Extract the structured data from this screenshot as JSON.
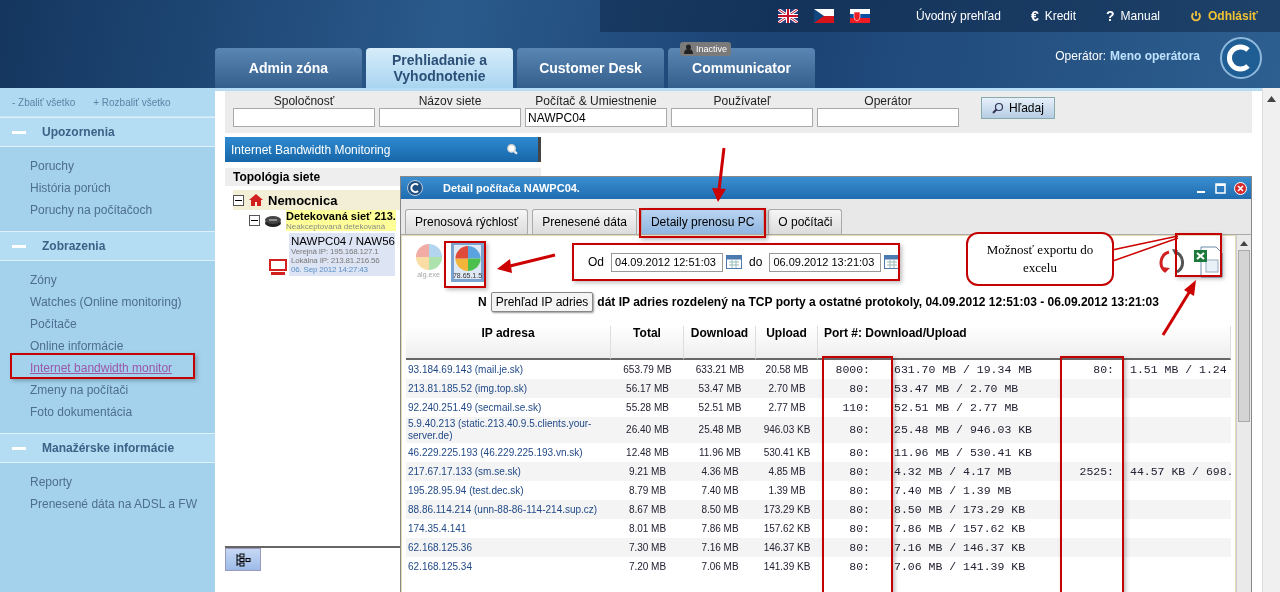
{
  "header": {
    "links": [
      {
        "label": "Úvodný prehľad",
        "kind": "plain"
      },
      {
        "label": "Kredit",
        "kind": "glyph",
        "glyph": "€"
      },
      {
        "label": "Manual",
        "kind": "glyph",
        "glyph": "?"
      },
      {
        "label": "Odhlásiť",
        "kind": "logout"
      }
    ],
    "tabs": [
      {
        "label": "Admin zóna",
        "selected": false
      },
      {
        "label": "Prehliadanie a Vyhodnotenie",
        "selected": true
      },
      {
        "label": "Customer Desk",
        "selected": false
      },
      {
        "label": "Communicator",
        "selected": false,
        "badge": "Inactive"
      }
    ],
    "operator": {
      "label": "Operátor:",
      "name": "Meno operátora"
    }
  },
  "sidebar": {
    "collapse_all": "- Zbaliť všetko",
    "expand_all": "+ Rozbaliť všetko",
    "sections": [
      {
        "title": "Upozornenia",
        "expanded": true,
        "items": [
          {
            "label": "Poruchy",
            "selected": false
          },
          {
            "label": "História porúch",
            "selected": false
          },
          {
            "label": "Poruchy na počítačoch",
            "selected": false
          }
        ]
      },
      {
        "title": "Zobrazenia",
        "expanded": true,
        "items": [
          {
            "label": "Zóny",
            "selected": false
          },
          {
            "label": "Watches (Online monitoring)",
            "selected": false
          },
          {
            "label": "Počítače",
            "selected": false
          },
          {
            "label": "Online informácie",
            "selected": false
          },
          {
            "label": "Internet bandwidth monitor",
            "selected": true
          },
          {
            "label": "Zmeny na počítači",
            "selected": false
          },
          {
            "label": "Foto dokumentácia",
            "selected": false
          }
        ]
      },
      {
        "title": "Manažérske informácie",
        "expanded": true,
        "items": [
          {
            "label": "Reporty",
            "selected": false
          },
          {
            "label": "Prenesené dáta na ADSL a FW",
            "selected": false
          }
        ]
      }
    ]
  },
  "search": {
    "fields": [
      {
        "label": "Spoločnosť"
      },
      {
        "label": "Názov siete"
      },
      {
        "label": "Počítač & Umiestnenie",
        "value": "NAWPC04"
      },
      {
        "label": "Používateľ"
      },
      {
        "label": "Operátor"
      }
    ],
    "button": "Hľadaj"
  },
  "monitor_panel": {
    "title": "Internet Bandwidth Monitoring",
    "tree_heading": "Topológia siete",
    "nodes": [
      {
        "label": "Nemocnica",
        "expanded": true,
        "children": [
          {
            "label": "Detekovaná sieť 213.",
            "note": "Neakceptovaná detekovaná",
            "expanded": true,
            "children": [
              {
                "label": "NAWPC04 / NAW56",
                "details": [
                  "Verejná IP: 195.168.127.1",
                  "Lokálna IP: 213.81.216.56"
                ],
                "time": "06. Sep 2012 14:27:43"
              }
            ]
          }
        ]
      }
    ]
  },
  "dialog": {
    "title": "Detail počítača NAWPC04.",
    "tabs": [
      {
        "label": "Prenosová rýchlosť",
        "selected": false
      },
      {
        "label": "Prenesené dáta",
        "selected": false
      },
      {
        "label": "Detaily prenosu PC",
        "selected": true
      },
      {
        "label": "O počítači",
        "selected": false
      }
    ],
    "views": [
      {
        "caption": "alg.exe",
        "selected": false
      },
      {
        "caption": "78.65.1.5",
        "selected": true
      }
    ],
    "date_from_label": "Od",
    "date_from": "04.09.2012 12:51:03",
    "date_to_label": "do",
    "date_to": "06.09.2012 13:21:03",
    "heading_start": "N",
    "tooltip": "Prehľad IP adries",
    "heading_rest": "dát IP adries rozdelený na TCP porty a ostatné protokoly, 04.09.2012 12:51:03 - 06.09.2012 13:21:03",
    "columns": [
      "IP adresa",
      "Total",
      "Download",
      "Upload",
      "Port #: Download/Upload"
    ],
    "rows": [
      {
        "ip": "93.184.69.143 (mail.je.sk)",
        "total": "653.79 MB",
        "download": "633.21 MB",
        "upload": "20.58 MB",
        "ports": [
          {
            "port": "8000:",
            "traffic": "631.70 MB / 19.34 MB"
          },
          {
            "port": "80:",
            "traffic": "1.51 MB / 1.24"
          }
        ]
      },
      {
        "ip": "213.81.185.52 (img.top.sk)",
        "total": "56.17 MB",
        "download": "53.47 MB",
        "upload": "2.70 MB",
        "ports": [
          {
            "port": "80:",
            "traffic": "53.47 MB / 2.70 MB"
          }
        ]
      },
      {
        "ip": "92.240.251.49 (secmail.se.sk)",
        "total": "55.28 MB",
        "download": "52.51 MB",
        "upload": "2.77 MB",
        "ports": [
          {
            "port": "110:",
            "traffic": "52.51 MB / 2.77 MB"
          }
        ]
      },
      {
        "ip": "5.9.40.213 (static.213.40.9.5.clients.your-server.de)",
        "total": "26.40 MB",
        "download": "25.48 MB",
        "upload": "946.03 KB",
        "ports": [
          {
            "port": "80:",
            "traffic": "25.48 MB / 946.03 KB"
          }
        ]
      },
      {
        "ip": "46.229.225.193 (46.229.225.193.vn.sk)",
        "total": "12.48 MB",
        "download": "11.96 MB",
        "upload": "530.41 KB",
        "ports": [
          {
            "port": "80:",
            "traffic": "11.96 MB / 530.41 KB"
          }
        ]
      },
      {
        "ip": "217.67.17.133 (sm.se.sk)",
        "total": "9.21 MB",
        "download": "4.36 MB",
        "upload": "4.85 MB",
        "ports": [
          {
            "port": "80:",
            "traffic": "4.32 MB / 4.17 MB"
          },
          {
            "port": "2525:",
            "traffic": "44.57 KB / 698."
          }
        ]
      },
      {
        "ip": "195.28.95.94 (test.dec.sk)",
        "total": "8.79 MB",
        "download": "7.40 MB",
        "upload": "1.39 MB",
        "ports": [
          {
            "port": "80:",
            "traffic": "7.40 MB / 1.39 MB"
          }
        ]
      },
      {
        "ip": "88.86.114.214 (unn-88-86-114-214.sup.cz)",
        "total": "8.67 MB",
        "download": "8.50 MB",
        "upload": "173.29 KB",
        "ports": [
          {
            "port": "80:",
            "traffic": "8.50 MB / 173.29 KB"
          }
        ]
      },
      {
        "ip": "174.35.4.141",
        "total": "8.01 MB",
        "download": "7.86 MB",
        "upload": "157.62 KB",
        "ports": [
          {
            "port": "80:",
            "traffic": "7.86 MB / 157.62 KB"
          }
        ]
      },
      {
        "ip": "62.168.125.36",
        "total": "7.30 MB",
        "download": "7.16 MB",
        "upload": "146.37 KB",
        "ports": [
          {
            "port": "80:",
            "traffic": "7.16 MB / 146.37 KB"
          }
        ]
      },
      {
        "ip": "62.168.125.34",
        "total": "7.20 MB",
        "download": "7.06 MB",
        "upload": "141.39 KB",
        "ports": [
          {
            "port": "80:",
            "traffic": "7.06 MB / 141.39 KB"
          }
        ]
      }
    ]
  },
  "callout": "Možnosť exportu do excelu"
}
